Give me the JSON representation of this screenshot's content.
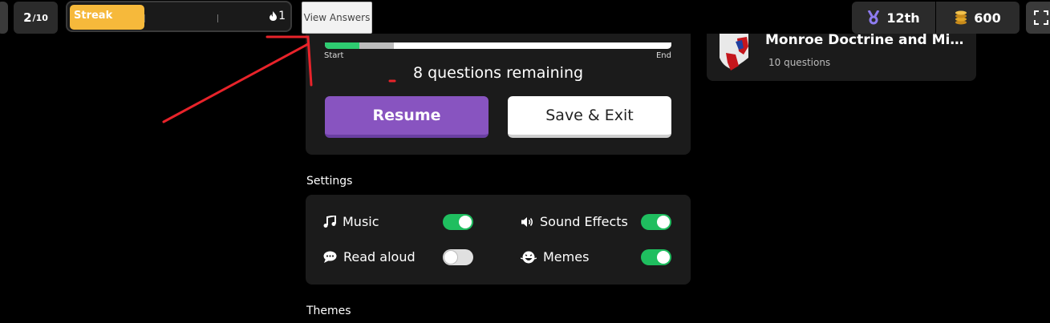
{
  "topbar": {
    "progress_current": "2",
    "progress_total": "/10",
    "streak_label": "Streak",
    "streak_count": "1",
    "view_answers_label": "View Answers",
    "rank_label": "12th",
    "coins_label": "600"
  },
  "main": {
    "progress_fraction": 0.1,
    "seen_fraction": 0.2,
    "start_label": "Start",
    "end_label": "End",
    "remaining_text": "8 questions remaining",
    "resume_label": "Resume",
    "save_exit_label": "Save & Exit"
  },
  "settings": {
    "heading": "Settings",
    "music": {
      "label": "Music",
      "on": true
    },
    "sound_effects": {
      "label": "Sound Effects",
      "on": true
    },
    "read_aloud": {
      "label": "Read aloud",
      "on": false
    },
    "memes": {
      "label": "Memes",
      "on": true
    }
  },
  "themes_heading": "Themes",
  "quiz_card": {
    "title": "Monroe Doctrine and Misso...",
    "count": "10 questions"
  },
  "colors": {
    "accent": "#8854c0",
    "toggle_on": "#1fbe5f",
    "streak": "#f6b93b",
    "annotation": "#e8232a"
  },
  "icons": {
    "streak": "flame-icon",
    "rank": "medal-icon",
    "coins": "coin-stack-icon",
    "fullscreen": "fullscreen-icon",
    "music": "music-note-icon",
    "sound": "speaker-icon",
    "read_aloud": "speech-bubble-icon",
    "memes": "laughing-face-icon"
  }
}
